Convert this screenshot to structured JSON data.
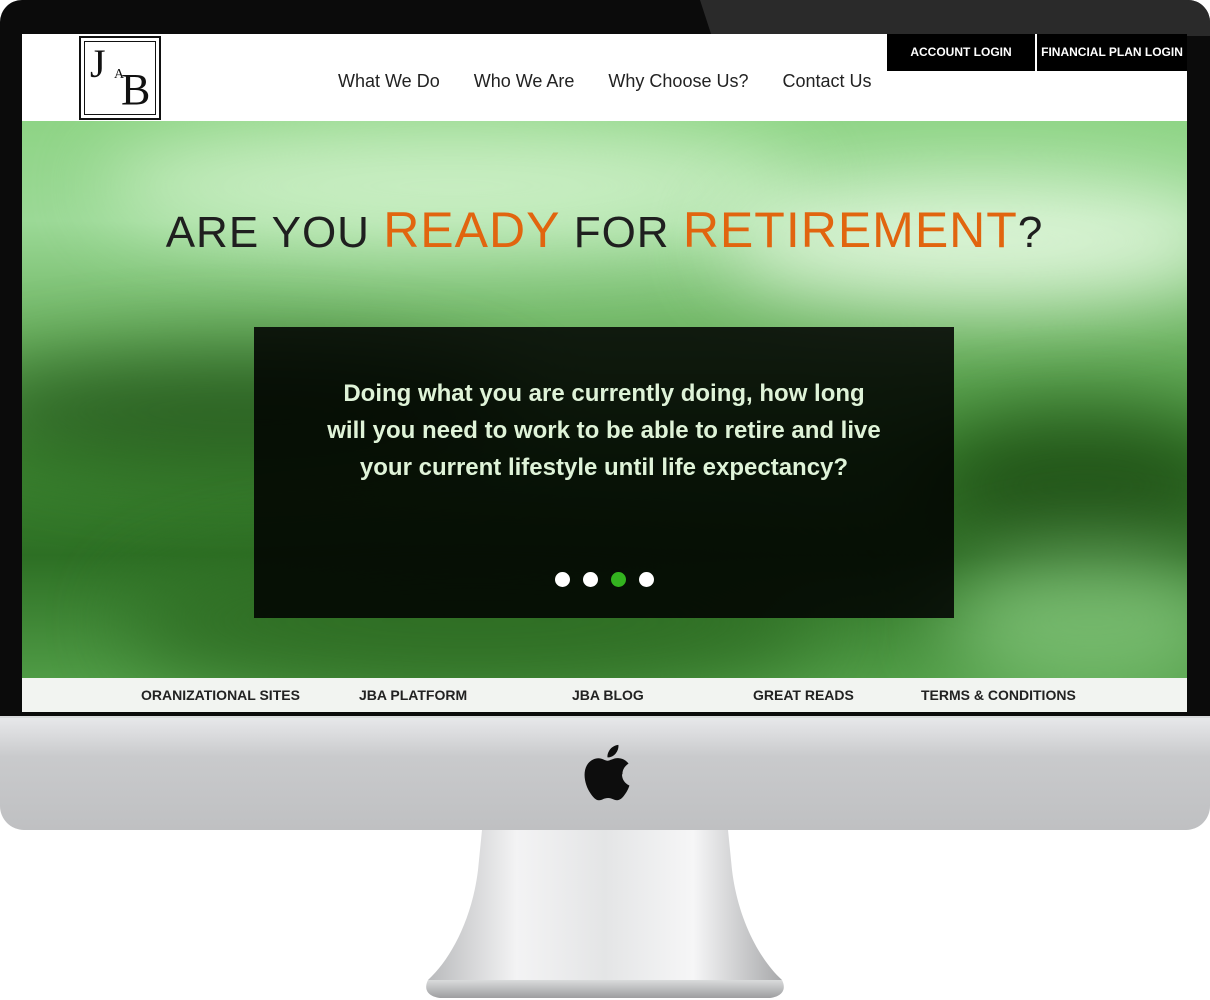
{
  "logo": {
    "letters": [
      "J",
      "A",
      "B"
    ]
  },
  "nav": {
    "items": [
      "What We Do",
      "Who We Are",
      "Why Choose Us?",
      "Contact Us"
    ]
  },
  "login": {
    "account": "ACCOUNT LOGIN",
    "financial_plan": "FINANCIAL PLAN LOGIN"
  },
  "hero": {
    "headline_part1": "ARE YOU",
    "headline_accent1": "READY",
    "headline_part2": "FOR",
    "headline_accent2": "RETIREMENT",
    "headline_end": "?",
    "quote": "Doing what you are currently doing, how long will you need to work to be able to retire and live your current lifestyle until life expectancy?",
    "slides_total": 4,
    "slide_active": 3
  },
  "footer": {
    "links": [
      "ORANIZATIONAL SITES",
      "JBA PLATFORM",
      "JBA BLOG",
      "GREAT READS",
      "TERMS & CONDITIONS"
    ]
  },
  "colors": {
    "accent": "#e1650f",
    "active_dot": "#33b31f",
    "quote_text": "#dff3d8"
  },
  "icons": {
    "apple": "apple-logo-icon"
  }
}
